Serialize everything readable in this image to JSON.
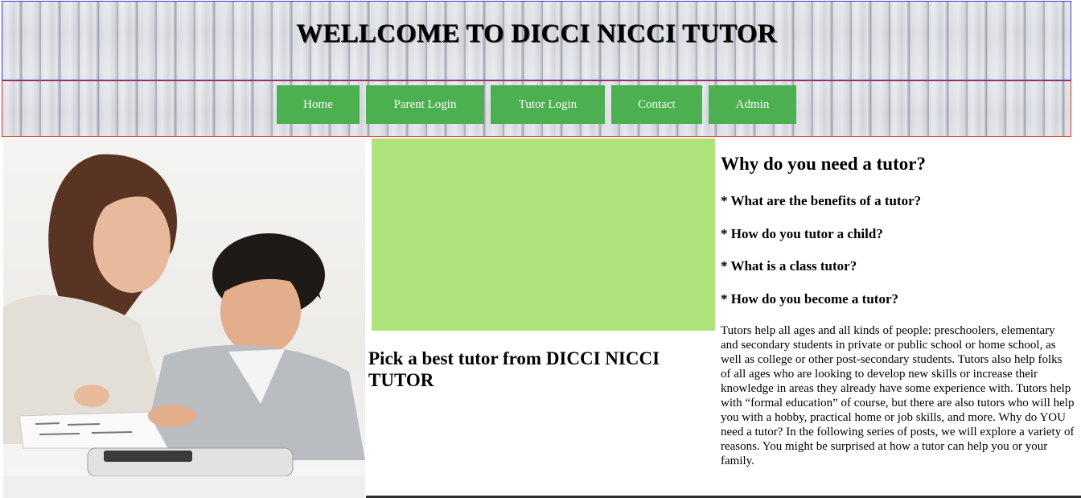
{
  "header": {
    "title": "WELLCOME TO DICCI NICCI TUTOR"
  },
  "nav": {
    "items": [
      {
        "label": "Home"
      },
      {
        "label": "Parent Login"
      },
      {
        "label": "Tutor Login"
      },
      {
        "label": "Contact"
      },
      {
        "label": "Admin"
      }
    ]
  },
  "main": {
    "image": {
      "name": "tutor-with-child-photo"
    },
    "banner_color": "#aee27a",
    "pick_heading": "Pick a best tutor from DICCI NICCI TUTOR"
  },
  "sidebar": {
    "heading": "Why do you need a tutor?",
    "questions": [
      "* What are the benefits of a tutor?",
      "* How do you tutor a child?",
      "* What is a class tutor?",
      "* How do you become a tutor?"
    ],
    "body": "Tutors help all ages and all kinds of people: preschoolers, elementary and secondary students in private or public school or home school, as well as college or other post-secondary students. Tutors also help folks of all ages who are looking to develop new skills or increase their knowledge in areas they already have some experience with. Tutors help with “formal education” of course, but there are also tutors who will help you with a hobby, practical home or job skills, and more. Why do YOU need a tutor? In the following series of posts, we will explore a variety of reasons. You might be surprised at how a tutor can help you or your family."
  },
  "colors": {
    "nav_button": "#4caf50",
    "header_border": "#3b3bd6",
    "nav_border": "#d62f2f"
  }
}
